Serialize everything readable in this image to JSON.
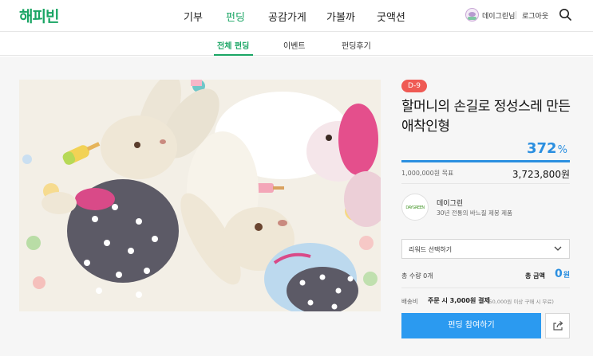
{
  "header": {
    "logo": "해피빈",
    "nav": [
      "기부",
      "펀딩",
      "공감가게",
      "가볼까",
      "굿액션"
    ],
    "active_nav": "펀딩",
    "user_name": "데이그린님",
    "logout": "로그아웃"
  },
  "subtabs": {
    "items": [
      "전체 펀딩",
      "이벤트",
      "펀딩후기"
    ],
    "active": "전체 펀딩"
  },
  "project": {
    "dday": "D-9",
    "title": "할머니의 손길로 정성스레 만든 애착인형",
    "percent": "372",
    "percent_sign": "%",
    "goal": "1,000,000원 목표",
    "raised": "3,723,800원",
    "maker": {
      "logo_text": "DAYGREEN",
      "name": "데이그린",
      "description": "30년 전통의 바느질 제봉 제품"
    },
    "reward_select": "리워드 선택하기",
    "quantity": "총 수량  0개",
    "total_label": "총 금액",
    "total_value": "0",
    "total_unit": "원",
    "shipping_label": "배송비",
    "shipping_value": "주문 시 3,000원 결제",
    "shipping_note": "(50,000원 이상 구매 시 무료)",
    "fund_button": "펀딩 참여하기"
  },
  "colors": {
    "brand_green": "#1aa564",
    "accent_blue": "#2b8fe0",
    "dday_red": "#ef5a54"
  },
  "icons": [
    "search-icon",
    "chevron-down-icon",
    "share-icon"
  ]
}
